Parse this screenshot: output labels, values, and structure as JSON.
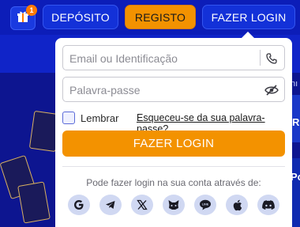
{
  "header": {
    "gift_badge": "1",
    "deposit_label": "DEPÓSITO",
    "register_label": "REGISTO",
    "login_label": "FAZER LOGIN"
  },
  "login_popup": {
    "email_placeholder": "Email ou Identificação",
    "password_placeholder": "Palavra-passe",
    "remember_label": "Lembrar",
    "forgot_label": "Esqueceu-se da sua palavra-passe?",
    "submit_label": "FAZER LOGIN",
    "social_text": "Pode fazer login na sua conta através de:",
    "social_providers": [
      "google-icon",
      "telegram-icon",
      "x-icon",
      "metamask-icon",
      "line-icon",
      "apple-icon",
      "discord-icon"
    ]
  },
  "background": {
    "side_text_1": "nı",
    "side_text_2": "R",
    "side_text_3": "Po"
  },
  "colors": {
    "accent": "#f39200",
    "header_bg": "#0c1db8",
    "button_blue": "#1331d8"
  }
}
